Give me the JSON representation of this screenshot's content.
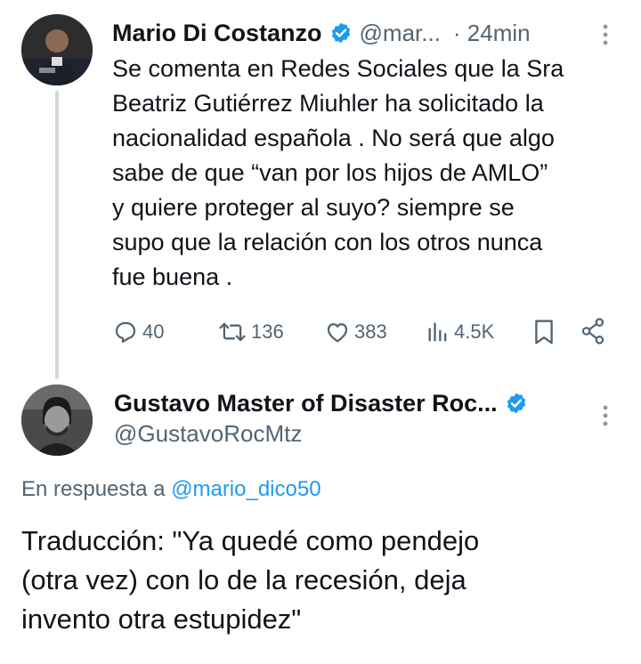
{
  "colors": {
    "link": "#1d9bf0",
    "secondary_text": "#536471",
    "thread_line": "#cfd9de",
    "verified": "#1d9bf0"
  },
  "tweet1": {
    "author_name": "Mario Di Costanzo",
    "handle": "@mar...",
    "time": "· 24min",
    "lines": [
      "Se comenta en Redes Sociales que la Sra",
      "Beatriz Gutiérrez Miuhler ha solicitado la",
      "nacionalidad española . No será que algo",
      "sabe de que “van por los hijos de AMLO”",
      "y quiere proteger al suyo? siempre se",
      "supo que la relación con los otros nunca",
      "fue buena ."
    ],
    "actions": {
      "replies": "40",
      "retweets": "136",
      "likes": "383",
      "views": "4.5K"
    },
    "icons": [
      "verified-badge-icon",
      "more-options-icon",
      "reply-icon",
      "retweet-icon",
      "like-icon",
      "views-icon",
      "bookmark-icon",
      "share-icon"
    ]
  },
  "tweet2": {
    "author_name": "Gustavo Master of Disaster Roc...",
    "handle": "@GustavoRocMtz",
    "reply_prefix": "En respuesta a",
    "reply_mention": "@mario_dico50",
    "lines": [
      "Traducción: \"Ya quedé como pendejo",
      "(otra vez) con lo de la recesión, deja",
      "invento otra estupidez\""
    ]
  }
}
